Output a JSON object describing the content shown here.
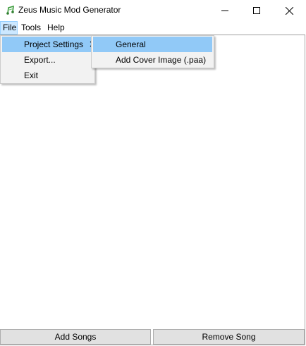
{
  "window": {
    "title": "Zeus Music Mod Generator",
    "icon": "music-note-icon",
    "controls": [
      "minimize-icon",
      "maximize-icon",
      "close-icon"
    ]
  },
  "menubar": {
    "items": [
      {
        "label": "File"
      },
      {
        "label": "Tools"
      },
      {
        "label": "Help"
      }
    ]
  },
  "file_menu": {
    "items": [
      {
        "label": "Project Settings",
        "has_submenu": true
      },
      {
        "label": "Export..."
      },
      {
        "label": "Exit"
      }
    ]
  },
  "project_settings_submenu": {
    "items": [
      {
        "label": "General"
      },
      {
        "label": "Add Cover Image (.paa)"
      }
    ]
  },
  "buttons": {
    "add_songs": "Add Songs",
    "remove_song": "Remove Song"
  },
  "colors": {
    "highlight": "#91c9f7",
    "menu_active": "#cce8ff",
    "menu_bg": "#f2f2f2",
    "button_bg": "#e1e1e1"
  }
}
